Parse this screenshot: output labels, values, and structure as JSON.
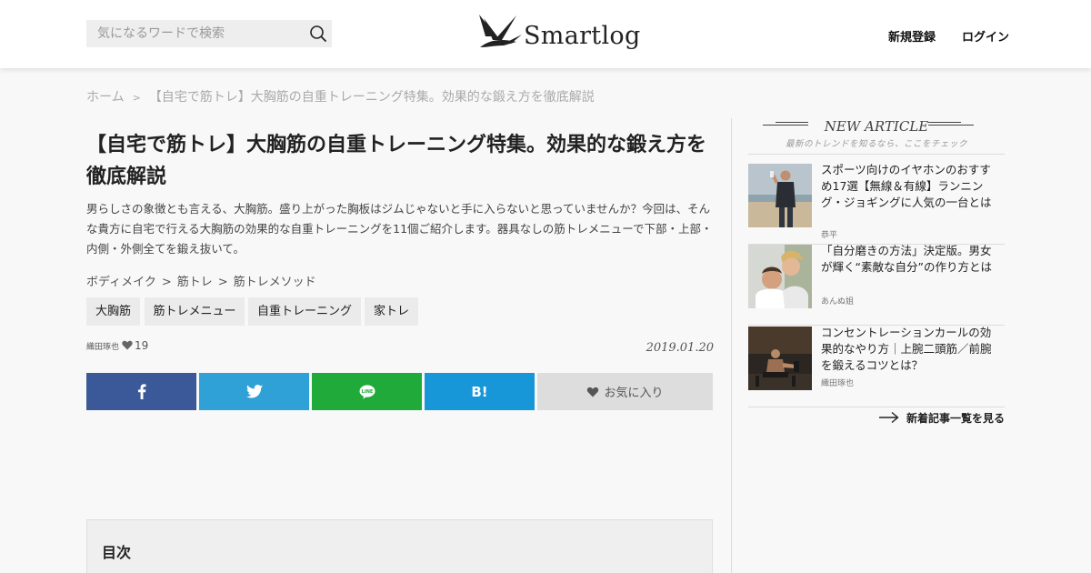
{
  "header": {
    "search_placeholder": "気になるワードで検索",
    "logo_text": "Smartlog",
    "signup": "新規登録",
    "login": "ログイン"
  },
  "breadcrumb": {
    "home": "ホーム",
    "separator": ">",
    "current": "【自宅で筋トレ】大胸筋の自重トレーニング特集。効果的な鍛え方を徹底解説"
  },
  "article": {
    "title": "【自宅で筋トレ】大胸筋の自重トレーニング特集。効果的な鍛え方を徹底解説",
    "lead": "男らしさの象徴とも言える、大胸筋。盛り上がった胸板はジムじゃないと手に入らないと思っていませんか？今回は、そんな貴方に自宅で行える大胸筋の効果的な自重トレーニングを11個ご紹介します。器具なしの筋トレメニューで下部・上部・内側・外側全てを鍛え抜いて。",
    "categories": [
      "ボディメイク",
      "筋トレ",
      "筋トレメソッド"
    ],
    "category_separator": ">",
    "tags": [
      "大胸筋",
      "筋トレメニュー",
      "自重トレーニング",
      "家トレ"
    ],
    "author": "織田琢也",
    "likes": "19",
    "date": "2019.01.20"
  },
  "share": {
    "facebook_color": "#3b5998",
    "twitter_color": "#2fa1d6",
    "line_color": "#1faa3a",
    "hatena_color": "#1897d8",
    "line_label": "LINE",
    "hatena_label": "B!",
    "favorite_label": "お気に入り"
  },
  "toc": {
    "title": "目次"
  },
  "sidebar": {
    "title": "NEW ARTICLE",
    "subtitle": "最新のトレンドを知るなら、ここをチェック",
    "articles": [
      {
        "title": "スポーツ向けのイヤホンのおすすめ17選【無線＆有線】ランニング・ジョギングに人気の一台とは",
        "author": "恭平"
      },
      {
        "title": "「自分磨きの方法」決定版。男女が輝く“素敵な自分”の作り方とは",
        "author": "あんぬ姐"
      },
      {
        "title": "コンセントレーションカールの効果的なやり方｜上腕二頭筋／前腕を鍛えるコツとは？",
        "author": "織田琢也"
      }
    ],
    "more_label": "新着記事一覧を見る"
  }
}
